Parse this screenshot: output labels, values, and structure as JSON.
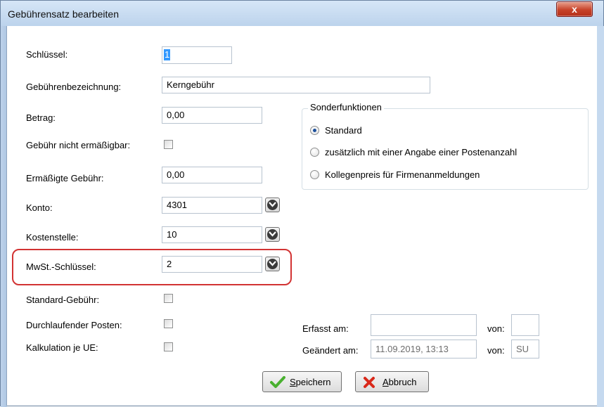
{
  "window": {
    "title": "Gebührensatz bearbeiten",
    "close_label": "x"
  },
  "fields": {
    "schluessel": {
      "label": "Schlüssel:",
      "value": "1"
    },
    "bezeichnung": {
      "label": "Gebührenbezeichnung:",
      "value": "Kerngebühr"
    },
    "betrag": {
      "label": "Betrag:",
      "value": "0,00"
    },
    "nicht_ermaessigbar": {
      "label": "Gebühr nicht ermäßigbar:",
      "checked": false
    },
    "ermaessigte_gebuehr": {
      "label": "Ermäßigte Gebühr:",
      "value": "0,00"
    },
    "konto": {
      "label": "Konto:",
      "value": "4301"
    },
    "kostenstelle": {
      "label": "Kostenstelle:",
      "value": "10"
    },
    "mwst": {
      "label": "MwSt.-Schlüssel:",
      "value": "2"
    },
    "standard_gebuehr": {
      "label": "Standard-Gebühr:",
      "checked": false
    },
    "durchlaufender_posten": {
      "label": "Durchlaufender Posten:",
      "checked": false
    },
    "kalkulation": {
      "label": "Kalkulation je UE:",
      "checked": false
    }
  },
  "sonderfunktionen": {
    "title": "Sonderfunktionen",
    "options": [
      {
        "label": "Standard",
        "checked": true
      },
      {
        "label": "zusätzlich mit einer Angabe einer Postenanzahl",
        "checked": false
      },
      {
        "label": "Kollegenpreis für Firmenanmeldungen",
        "checked": false
      }
    ]
  },
  "meta": {
    "erfasst_label": "Erfasst am:",
    "erfasst_value": "",
    "erfasst_von_label": "von:",
    "erfasst_von_value": "",
    "geaendert_label": "Geändert am:",
    "geaendert_value": "11.09.2019, 13:13",
    "geaendert_von_label": "von:",
    "geaendert_von_value": "SU"
  },
  "buttons": {
    "save_prefix": "",
    "save_accel": "S",
    "save_rest": "peichern",
    "cancel_accel": "A",
    "cancel_rest": "bbruch"
  },
  "colors": {
    "highlight": "#d23333",
    "save_icon": "#49b02f",
    "cancel_icon": "#d9281a"
  }
}
